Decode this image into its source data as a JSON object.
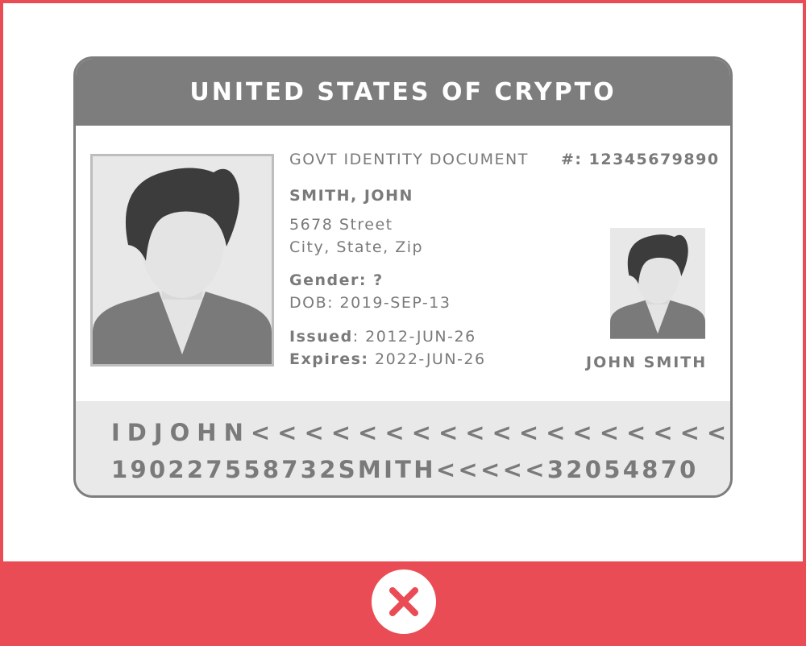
{
  "card": {
    "title": "UNITED STATES OF CRYPTO",
    "document_type": "GOVT IDENTITY DOCUMENT",
    "document_number": "#: 12345679890",
    "holder_name": "SMITH, JOHN",
    "address_line1": "5678 Street",
    "address_line2": "City, State, Zip",
    "gender": "Gender: ?",
    "dob": "DOB: 2019-SEP-13",
    "issued_label": "Issued",
    "issued_value": ": 2012-JUN-26",
    "expires_label": "Expires:",
    "expires_value": " 2022-JUN-26",
    "signature_name": "JOHN SMITH",
    "mrz_line1": "IDJOHN<<<<<<<<<<<<<<<<<<<<<<<<<",
    "mrz_line2": "190227558732SMITH<<<<<32054870"
  },
  "icons": {
    "photo": "person-silhouette-icon",
    "reject": "close-icon"
  },
  "colors": {
    "accent": "#e94c55",
    "card_header": "#7d7d7d",
    "mrz_background": "#e9e9e9",
    "text": "#7a7a7a"
  }
}
